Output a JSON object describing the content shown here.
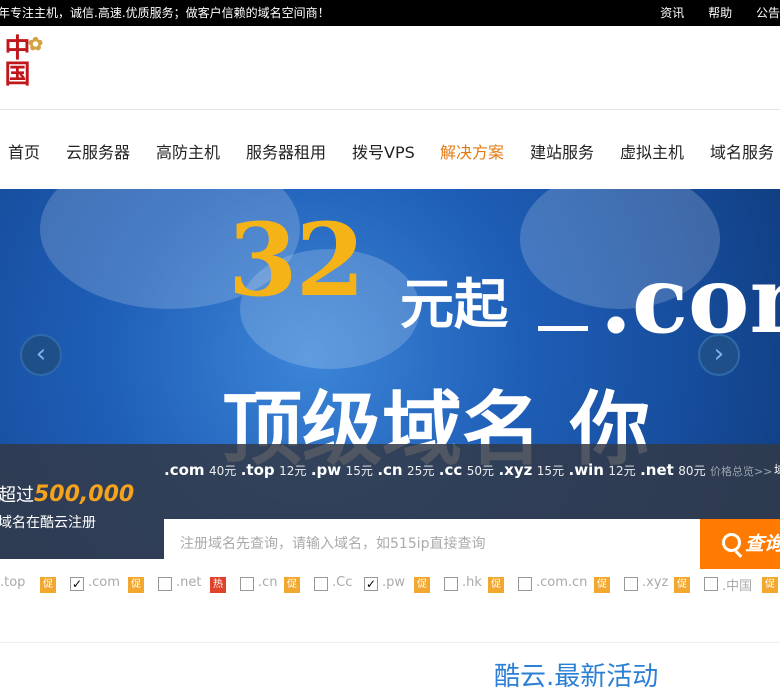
{
  "topbar": {
    "slogan": "年专注主机，诚信.高速.优质服务；做客户信赖的域名空间商！",
    "links": [
      "资讯",
      "帮助",
      "公告"
    ]
  },
  "logo": {
    "text": "中国"
  },
  "nav": {
    "items": [
      {
        "label": "首页"
      },
      {
        "label": "云服务器"
      },
      {
        "label": "高防主机"
      },
      {
        "label": "服务器租用"
      },
      {
        "label": "拨号VPS"
      },
      {
        "label": "解决方案",
        "active": true
      },
      {
        "label": "建站服务"
      },
      {
        "label": "虚拟主机"
      },
      {
        "label": "域名服务"
      }
    ]
  },
  "banner": {
    "price": "32",
    "price_suffix": "元起",
    "extension": ".com",
    "headline": "顶级域名  你",
    "prev_icon": "chevron-left-icon",
    "next_icon": "chevron-right-icon"
  },
  "domain_panel": {
    "stat_prefix": "超过",
    "stat_number": "500,000",
    "stat_caption": "域名在酷云注册",
    "prices": [
      {
        "ext": ".com",
        "price": "40元"
      },
      {
        "ext": ".top",
        "price": "12元"
      },
      {
        "ext": ".pw",
        "price": "15元"
      },
      {
        "ext": ".cn",
        "price": "25元"
      },
      {
        "ext": ".cc",
        "price": "50元"
      },
      {
        "ext": ".xyz",
        "price": "15元"
      },
      {
        "ext": ".win",
        "price": "12元"
      },
      {
        "ext": ".net",
        "price": "80元"
      }
    ],
    "price_more": "价格总览>>",
    "price_extra": "域",
    "search_placeholder": "注册域名先查询，请输入域名，如515ip直接查询",
    "search_button": "查询"
  },
  "tld_options": [
    {
      "label": ".top",
      "badge": "促",
      "badge_type": "promo"
    },
    {
      "label": ".com",
      "badge": "促",
      "badge_type": "promo",
      "checked": true
    },
    {
      "label": ".net",
      "badge": "热",
      "badge_type": "hot",
      "checked": false
    },
    {
      "label": ".cn",
      "badge": "促",
      "badge_type": "promo",
      "checked": false
    },
    {
      "label": ".Cc",
      "badge": "",
      "checked": false
    },
    {
      "label": ".pw",
      "badge": "促",
      "badge_type": "promo",
      "checked": true
    },
    {
      "label": ".hk",
      "badge": "促",
      "badge_type": "promo",
      "checked": false
    },
    {
      "label": ".com.cn",
      "badge": "促",
      "badge_type": "promo",
      "checked": false
    },
    {
      "label": ".xyz",
      "badge": "促",
      "badge_type": "promo",
      "checked": false
    },
    {
      "label": ".中国",
      "badge": "促",
      "badge_type": "promo",
      "checked": false
    }
  ],
  "section": {
    "title": "酷云.最新活动"
  },
  "colors": {
    "accent": "#ff7a00",
    "nav_active": "#e37b14",
    "link_blue": "#2b7fd5",
    "gold": "#f5b318"
  }
}
